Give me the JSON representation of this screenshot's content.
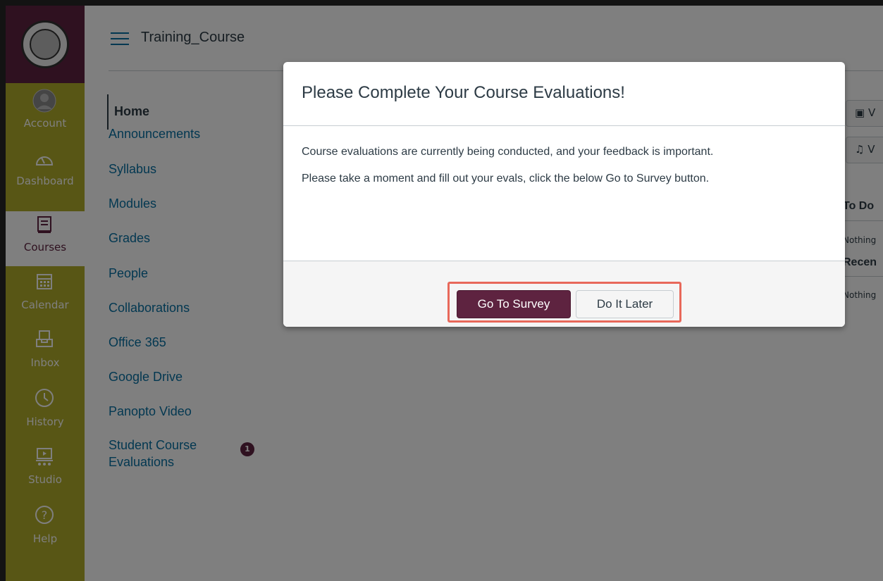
{
  "global_nav": {
    "items": [
      {
        "label": "Account",
        "icon": "account-icon"
      },
      {
        "label": "Dashboard",
        "icon": "dashboard-icon"
      },
      {
        "label": "Courses",
        "icon": "courses-icon"
      },
      {
        "label": "Calendar",
        "icon": "calendar-icon"
      },
      {
        "label": "Inbox",
        "icon": "inbox-icon"
      },
      {
        "label": "History",
        "icon": "history-icon"
      },
      {
        "label": "Studio",
        "icon": "studio-icon"
      },
      {
        "label": "Help",
        "icon": "help-icon"
      }
    ],
    "active": "Courses"
  },
  "header": {
    "breadcrumb": "Training_Course"
  },
  "course_nav": {
    "items": [
      {
        "label": "Home"
      },
      {
        "label": "Announcements"
      },
      {
        "label": "Syllabus"
      },
      {
        "label": "Modules"
      },
      {
        "label": "Grades"
      },
      {
        "label": "People"
      },
      {
        "label": "Collaborations"
      },
      {
        "label": "Office 365"
      },
      {
        "label": "Google Drive"
      },
      {
        "label": "Panopto Video"
      },
      {
        "label": "Student Course Evaluations",
        "badge": "1"
      }
    ]
  },
  "right_sidebar": {
    "btn1": "V",
    "btn2": "V",
    "todo_heading": "To Do",
    "todo_empty": "Nothing",
    "recent_heading": "Recen",
    "recent_empty": "Nothing"
  },
  "modal": {
    "title": "Please Complete Your Course Evaluations!",
    "para1": "Course evaluations are currently being conducted, and your feedback is important.",
    "para2": "Please take a moment and fill out your evals, click the below Go to Survey button.",
    "primary_button": "Go To Survey",
    "secondary_button": "Do It Later"
  },
  "colors": {
    "brand": "#5e2340",
    "nav_bg": "#b0ac2a",
    "link": "#0770a3",
    "highlight": "#e8685a"
  }
}
